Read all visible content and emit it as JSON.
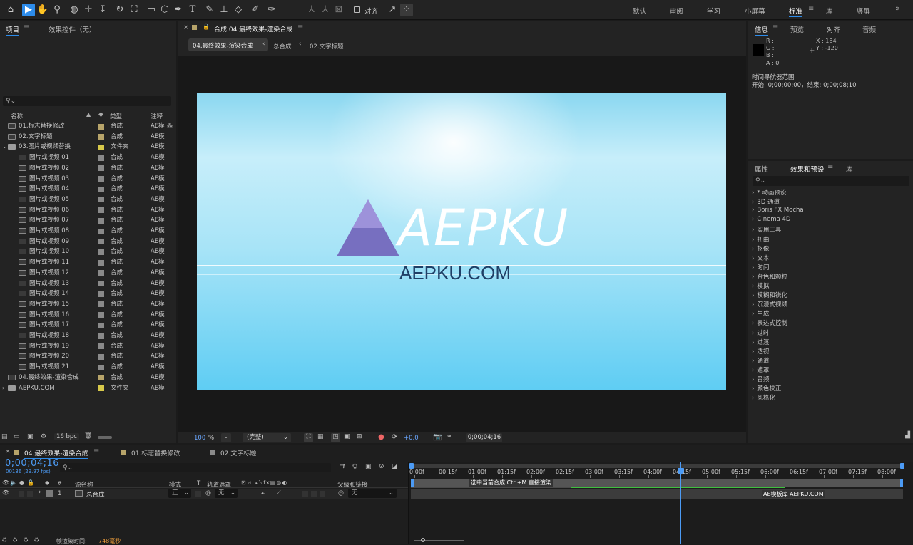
{
  "toolbar": {
    "align_label": "对齐",
    "workspaces": [
      "默认",
      "审阅",
      "学习",
      "小屏幕",
      "标准",
      "库",
      "竖屏"
    ],
    "active_workspace": "标准"
  },
  "project": {
    "tab_project": "项目",
    "tab_effects": "效果控件（无）",
    "columns": {
      "name": "名称",
      "type": "类型",
      "comment": "注释"
    },
    "items": [
      {
        "name": "01.标志替换修改",
        "type": "合成",
        "comment": "AE模",
        "label": "#b7a46a",
        "kind": "comp",
        "indent": 0,
        "comment_icon": true
      },
      {
        "name": "02.文字标题",
        "type": "合成",
        "comment": "AE模",
        "label": "#b7a46a",
        "kind": "comp",
        "indent": 0
      },
      {
        "name": "03.图片或视频替换",
        "type": "文件夹",
        "comment": "AE模",
        "label": "#d8c94a",
        "kind": "folder",
        "indent": 0,
        "open": true
      },
      {
        "name": "图片或视频 01",
        "type": "合成",
        "comment": "AE模",
        "label": "#8a8a8a",
        "kind": "comp",
        "indent": 1
      },
      {
        "name": "图片或视频 02",
        "type": "合成",
        "comment": "AE模",
        "label": "#8a8a8a",
        "kind": "comp",
        "indent": 1
      },
      {
        "name": "图片或视频 03",
        "type": "合成",
        "comment": "AE模",
        "label": "#8a8a8a",
        "kind": "comp",
        "indent": 1
      },
      {
        "name": "图片或视频 04",
        "type": "合成",
        "comment": "AE模",
        "label": "#8a8a8a",
        "kind": "comp",
        "indent": 1
      },
      {
        "name": "图片或视频 05",
        "type": "合成",
        "comment": "AE模",
        "label": "#8a8a8a",
        "kind": "comp",
        "indent": 1
      },
      {
        "name": "图片或视频 06",
        "type": "合成",
        "comment": "AE模",
        "label": "#8a8a8a",
        "kind": "comp",
        "indent": 1
      },
      {
        "name": "图片或视频 07",
        "type": "合成",
        "comment": "AE模",
        "label": "#8a8a8a",
        "kind": "comp",
        "indent": 1
      },
      {
        "name": "图片或视频 08",
        "type": "合成",
        "comment": "AE模",
        "label": "#8a8a8a",
        "kind": "comp",
        "indent": 1
      },
      {
        "name": "图片或视频 09",
        "type": "合成",
        "comment": "AE模",
        "label": "#8a8a8a",
        "kind": "comp",
        "indent": 1
      },
      {
        "name": "图片或视频 10",
        "type": "合成",
        "comment": "AE模",
        "label": "#8a8a8a",
        "kind": "comp",
        "indent": 1
      },
      {
        "name": "图片或视频 11",
        "type": "合成",
        "comment": "AE模",
        "label": "#8a8a8a",
        "kind": "comp",
        "indent": 1
      },
      {
        "name": "图片或视频 12",
        "type": "合成",
        "comment": "AE模",
        "label": "#8a8a8a",
        "kind": "comp",
        "indent": 1
      },
      {
        "name": "图片或视频 13",
        "type": "合成",
        "comment": "AE模",
        "label": "#8a8a8a",
        "kind": "comp",
        "indent": 1
      },
      {
        "name": "图片或视频 14",
        "type": "合成",
        "comment": "AE模",
        "label": "#8a8a8a",
        "kind": "comp",
        "indent": 1
      },
      {
        "name": "图片或视频 15",
        "type": "合成",
        "comment": "AE模",
        "label": "#8a8a8a",
        "kind": "comp",
        "indent": 1
      },
      {
        "name": "图片或视频 16",
        "type": "合成",
        "comment": "AE模",
        "label": "#8a8a8a",
        "kind": "comp",
        "indent": 1
      },
      {
        "name": "图片或视频 17",
        "type": "合成",
        "comment": "AE模",
        "label": "#8a8a8a",
        "kind": "comp",
        "indent": 1
      },
      {
        "name": "图片或视频 18",
        "type": "合成",
        "comment": "AE模",
        "label": "#8a8a8a",
        "kind": "comp",
        "indent": 1
      },
      {
        "name": "图片或视频 19",
        "type": "合成",
        "comment": "AE模",
        "label": "#8a8a8a",
        "kind": "comp",
        "indent": 1
      },
      {
        "name": "图片或视频 20",
        "type": "合成",
        "comment": "AE模",
        "label": "#8a8a8a",
        "kind": "comp",
        "indent": 1
      },
      {
        "name": "图片或视频 21",
        "type": "合成",
        "comment": "AE模",
        "label": "#8a8a8a",
        "kind": "comp",
        "indent": 1
      },
      {
        "name": "04.最终效果-渲染合成",
        "type": "合成",
        "comment": "AE模",
        "label": "#b7a46a",
        "kind": "comp",
        "indent": 0
      },
      {
        "name": "AEPKU.COM",
        "type": "文件夹",
        "comment": "AE模",
        "label": "#d8c94a",
        "kind": "folder",
        "indent": 0
      }
    ],
    "bpc": "16 bpc"
  },
  "composition": {
    "tab_title": "合成 04.最终效果-渲染合成",
    "breadcrumbs": [
      "04.最终效果-渲染合成",
      "总合成",
      "02.文字标题"
    ],
    "preview_logo": "AEPKU",
    "preview_url": "AEPKU.COM",
    "zoom": "100",
    "zoom_unit": "%",
    "resolution": "(完整)",
    "exposure": "+0.0",
    "timecode": "0;00;04;16"
  },
  "info": {
    "tabs": [
      "信息",
      "预览",
      "对齐",
      "音频"
    ],
    "r": "R :",
    "g": "G :",
    "b": "B :",
    "a": "A : 0",
    "x": "X : 184",
    "y": "Y : -120",
    "nav_title": "时间导航器范围",
    "nav_range": "开始: 0;00;00;00，结束: 0;00;08;10"
  },
  "effects": {
    "tabs": [
      "属性",
      "效果和预设",
      "库"
    ],
    "items": [
      "* 动画预设",
      "3D 通道",
      "Boris FX Mocha",
      "Cinema 4D",
      "实用工具",
      "扭曲",
      "抠像",
      "文本",
      "时间",
      "杂色和颗粒",
      "模拟",
      "模糊和锐化",
      "沉浸式视频",
      "生成",
      "表达式控制",
      "过时",
      "过渡",
      "透视",
      "通道",
      "遮罩",
      "音频",
      "颜色校正",
      "风格化"
    ]
  },
  "timeline": {
    "tabs": [
      "04.最终效果-渲染合成",
      "01.标志替换修改",
      "02.文字标题"
    ],
    "timecode": "0;00;04;16",
    "frame_info": "00136 (29.97 fps)",
    "headers": {
      "name": "源名称",
      "mode": "模式",
      "t": "T",
      "track_matte": "轨道遮罩",
      "parent": "父级和链接",
      "num": "#"
    },
    "ticks": [
      "0:00f",
      "00:15f",
      "01:00f",
      "01:15f",
      "02:00f",
      "02:15f",
      "03:00f",
      "03:15f",
      "04:00f",
      "04:15f",
      "05:00f",
      "05:15f",
      "06:00f",
      "06:15f",
      "07:00f",
      "07:15f",
      "08:00f"
    ],
    "work_area_label": "选中当前合成  Ctrl+M  直接渲染",
    "layer": {
      "index": "1",
      "name": "总合成",
      "mode": "正",
      "matte": "无",
      "parent": "无"
    },
    "layer_marker": "AE模板库  AEPKU.COM",
    "render_time_label": "帧渲染时间:",
    "render_time_value": "748毫秒",
    "playhead_fraction": 0.5476
  }
}
